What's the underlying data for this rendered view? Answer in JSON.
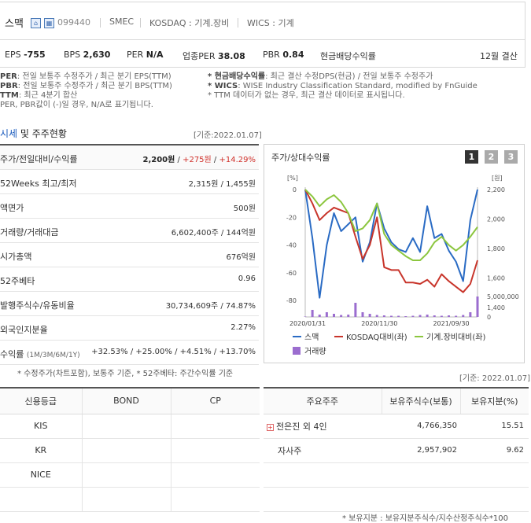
{
  "header": {
    "company_name": "스맥",
    "icon1": "house-icon",
    "icon2": "building-icon",
    "code": "099440",
    "english_name": "SMEC",
    "market": "KOSDAQ : 기계.장비",
    "wics": "WICS : 기계"
  },
  "metrics": {
    "eps_label": "EPS",
    "eps_value": "-755",
    "bps_label": "BPS",
    "bps_value": "2,630",
    "per_label": "PER",
    "per_value": "N/A",
    "sector_per_label": "업종PER",
    "sector_per_value": "38.08",
    "pbr_label": "PBR",
    "pbr_value": "0.84",
    "dividend_label": "현금배당수익률",
    "fiscal": "12월 결산"
  },
  "notes_left": [
    {
      "key": "PER",
      "text": ": 전일 보통주 수정주가 / 최근 분기 EPS(TTM)"
    },
    {
      "key": "PBR",
      "text": ": 전일 보통주 수정주가 / 최근 분기 BPS(TTM)"
    },
    {
      "key": "TTM",
      "text": ": 최근 4분기 합산"
    },
    {
      "key": "",
      "text": "PER, PBR값이 (-)일 경우, N/A로 표기됩니다."
    }
  ],
  "notes_right": [
    {
      "key": "* 현금배당수익률",
      "text": ": 최근 결산 수정DPS(현금) / 전일 보통주 수정주가"
    },
    {
      "key": "* WICS",
      "text": ": WISE Industry Classification Standard, modified by FnGuide"
    },
    {
      "key": "",
      "text": "* TTM 데이터가 없는 경우, 최근 결산 데이터로 표시됩니다."
    }
  ],
  "section": {
    "title_accent": "시세",
    "title_rest": " 및 주주현황",
    "date": "[기준:2022.01.07]"
  },
  "left_rows": [
    {
      "label": "주가/전일대비/수익률"
    },
    {
      "label": "52Weeks 최고/최저",
      "value": "2,315원 / 1,455원"
    },
    {
      "label": "액면가",
      "value": "500원"
    },
    {
      "label": "거래량/거래대금",
      "value": "6,602,400주 / 144억원"
    },
    {
      "label": "시가총액",
      "value": "676억원"
    },
    {
      "label": "52주베타",
      "value": "0.96"
    },
    {
      "label": "발행주식수/유동비율",
      "value": "30,734,609주 / 74.87%"
    },
    {
      "label": "외국인지분율",
      "value": "2.27%"
    },
    {
      "label": "수익률"
    }
  ],
  "price_row": {
    "price": "2,200원",
    "change": "+275원",
    "rate": "+14.29%",
    "sep": " / "
  },
  "returns_row": {
    "periods": "(1M/3M/6M/1Y)",
    "values": "+32.53% / +25.00% / +4.51% / +13.70%"
  },
  "left_footnote": "* 수정주가(차트포함), 보통주 기준, * 52주베타: 주간수익률 기준",
  "chart": {
    "title": "주가/상대수익률",
    "buttons": [
      "1",
      "2",
      "3"
    ],
    "left_unit": "[%]",
    "right_unit": "[원]"
  },
  "chart_data": {
    "type": "line",
    "x": [
      "2020/01/31",
      "",
      "",
      "",
      "",
      "",
      "",
      "",
      "",
      "",
      "2020/11/30",
      "",
      "",
      "",
      "",
      "",
      "",
      "",
      "",
      "",
      "2021/09/30",
      "",
      "",
      "",
      ""
    ],
    "x_tick_labels": [
      "2020/01/31",
      "2020/11/30",
      "2021/09/30"
    ],
    "yleft_ticks": [
      "0",
      "-20",
      "-40",
      "-60",
      "-80"
    ],
    "yleft_lim": [
      -85,
      0
    ],
    "yright_ticks": [
      "2,200",
      "2,000",
      "1,800",
      "1,600",
      "1,400"
    ],
    "yright_lim": [
      1400,
      2200
    ],
    "volume_ticks": [
      "5,000,000",
      "0"
    ],
    "series": [
      {
        "name": "스맥",
        "color": "#2a6bc4",
        "values": [
          0,
          -35,
          -78,
          -40,
          -17,
          -30,
          -25,
          -20,
          -52,
          -38,
          -10,
          -28,
          -38,
          -43,
          -45,
          -35,
          -45,
          -12,
          -35,
          -32,
          -44,
          -52,
          -66,
          -22,
          0
        ]
      },
      {
        "name": "KOSDAQ대비(좌)",
        "color": "#c8352b",
        "values": [
          0,
          -10,
          -22,
          -17,
          -13,
          -15,
          -17,
          -34,
          -50,
          -40,
          -20,
          -56,
          -58,
          -58,
          -67,
          -67,
          -68,
          -65,
          -70,
          -61,
          -66,
          -70,
          -74,
          -68,
          -51
        ]
      },
      {
        "name": "기계.장비대비(좌)",
        "color": "#8cc63f",
        "values": [
          0,
          -5,
          -12,
          -7,
          -4,
          -9,
          -17,
          -30,
          -28,
          -22,
          -10,
          -32,
          -40,
          -44,
          -48,
          -51,
          -51,
          -46,
          -38,
          -34,
          -40,
          -44,
          -40,
          -34,
          -27
        ]
      }
    ],
    "volume": {
      "name": "거래량",
      "color": "#9b6dcf",
      "values": [
        5,
        90,
        30,
        60,
        40,
        25,
        30,
        180,
        60,
        40,
        25,
        20,
        15,
        15,
        10,
        15,
        25,
        30,
        20,
        15,
        20,
        15,
        25,
        60,
        260
      ]
    }
  },
  "date2": "[기준: 2022.01.07]",
  "credit": {
    "headers": [
      "신용등급",
      "BOND",
      "CP"
    ],
    "rows": [
      [
        "KIS",
        "",
        ""
      ],
      [
        "KR",
        "",
        ""
      ],
      [
        "NICE",
        "",
        ""
      ],
      [
        "",
        "",
        ""
      ]
    ]
  },
  "holders": {
    "headers": [
      "주요주주",
      "보유주식수(보통)",
      "보유지분(%)"
    ],
    "rows": [
      {
        "name": "전은진 외 4인",
        "plus": "+",
        "shares": "4,766,350",
        "pct": "15.51"
      },
      {
        "name": "자사주",
        "plus": "",
        "shares": "2,957,902",
        "pct": "9.62"
      }
    ]
  },
  "bottom_note": "* 보유지분 : 보유지분주식수/지수산정주식수*100"
}
